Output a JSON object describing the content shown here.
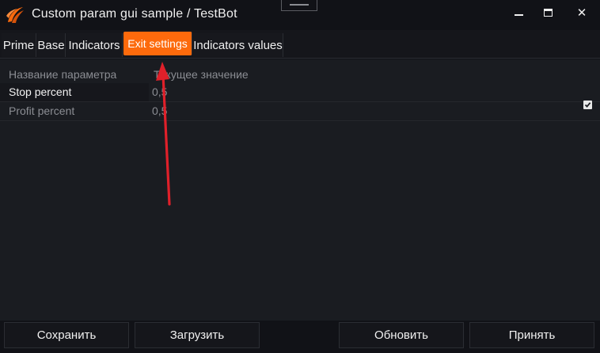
{
  "window": {
    "title": "Custom param gui sample / TestBot",
    "icons": {
      "logo": "osengine-logo-icon",
      "minimize": "minimize-icon",
      "maximize": "maximize-icon",
      "close": "close-icon"
    },
    "close_glyph": "✕"
  },
  "tabs": [
    {
      "label": "Prime",
      "active": false
    },
    {
      "label": "Base",
      "active": false
    },
    {
      "label": "Indicators",
      "active": false
    },
    {
      "label": "Exit settings",
      "active": true
    },
    {
      "label": "Indicators values",
      "active": false
    }
  ],
  "grid": {
    "headers": {
      "name": "Название параметра",
      "value": "Текущее значение"
    },
    "rows": [
      {
        "name": "Stop percent",
        "value": "0,5"
      },
      {
        "name": "Profit percent",
        "value": "0,5"
      }
    ],
    "checkbox_checked": true
  },
  "footer": {
    "save": "Сохранить",
    "load": "Загрузить",
    "refresh": "Обновить",
    "accept": "Принять"
  },
  "colors": {
    "accent": "#fd6a0c",
    "background": "#1a1c21",
    "annotation_arrow": "#e0202a"
  }
}
